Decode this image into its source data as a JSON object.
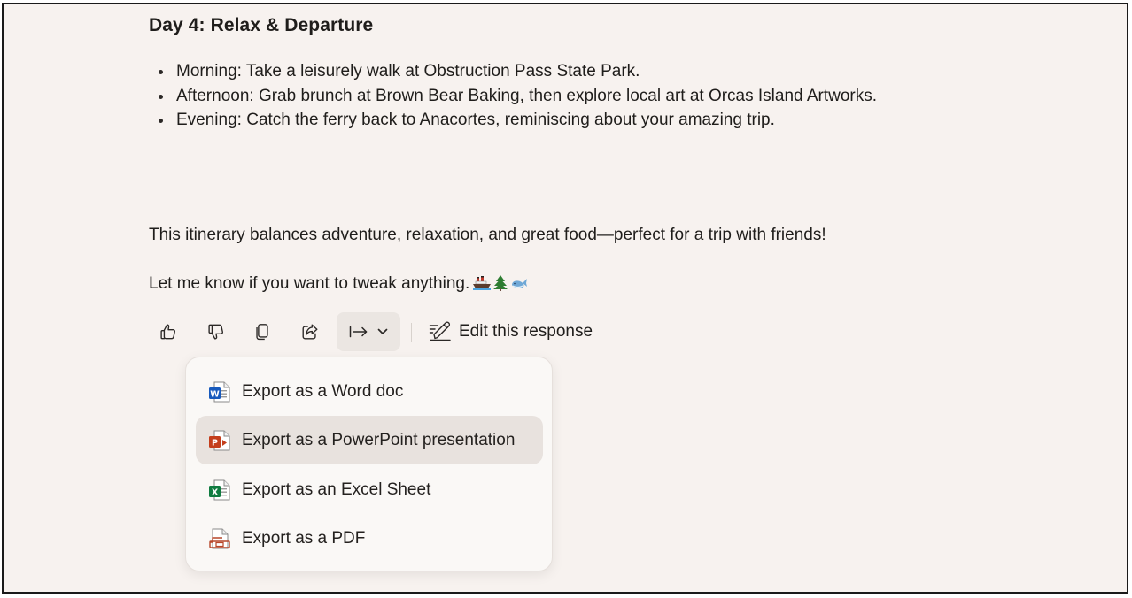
{
  "response": {
    "day_heading": "Day 4: Relax & Departure",
    "bullets": [
      "Morning: Take a leisurely walk at Obstruction Pass State Park.",
      "Afternoon: Grab brunch at Brown Bear Baking, then explore local art at Orcas Island Artworks.",
      "Evening: Catch the ferry back to Anacortes, reminiscing about your amazing trip."
    ],
    "summary": "This itinerary balances adventure, relaxation, and great food—perfect for a trip with friends!",
    "closing": "Let me know if you want to tweak anything.",
    "closing_emojis": [
      "ship-emoji",
      "evergreen-tree-emoji",
      "whale-emoji"
    ]
  },
  "toolbar": {
    "icons": [
      "thumbs-up-icon",
      "thumbs-down-icon",
      "copy-icon",
      "share-icon",
      "export-arrow-icon",
      "chevron-down-icon",
      "edit-pencil-icon"
    ],
    "edit_label": "Edit this response"
  },
  "export_menu": {
    "items": [
      {
        "label": "Export as a Word doc",
        "icon": "word-doc-icon",
        "color": "#185abd",
        "highlighted": false
      },
      {
        "label": "Export as a PowerPoint presentation",
        "icon": "powerpoint-icon",
        "color": "#c43e1c",
        "highlighted": true
      },
      {
        "label": "Export as an Excel Sheet",
        "icon": "excel-sheet-icon",
        "color": "#107c41",
        "highlighted": false
      },
      {
        "label": "Export as a PDF",
        "icon": "pdf-icon",
        "color": "#b7472a",
        "highlighted": false
      }
    ]
  },
  "colors": {
    "background": "#f7f2ef",
    "menu_background": "#faf8f6",
    "highlight": "#e8e2de",
    "text": "#1f1d1b"
  }
}
